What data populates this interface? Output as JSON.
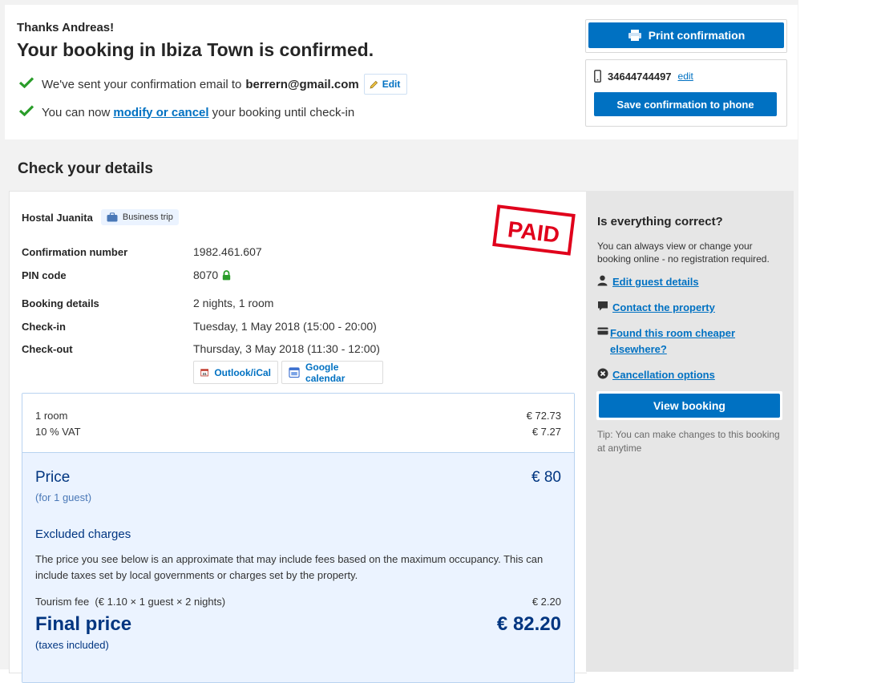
{
  "header": {
    "thanks": "Thanks Andreas!",
    "headline": "Your booking in Ibiza Town is confirmed.",
    "email_prefix": "We've sent your confirmation email to",
    "email": "berrern@gmail.com",
    "email_edit_label": "Edit",
    "modify_prefix": "You can now",
    "modify_link": "modify or cancel",
    "modify_suffix": "your booking until check-in",
    "print_label": "Print confirmation",
    "phone_number": "34644744497",
    "phone_edit": "edit",
    "save_phone_label": "Save confirmation to phone"
  },
  "section_title": "Check your details",
  "details": {
    "hotel_name": "Hostal Juanita",
    "trip_badge": "Business trip",
    "stamp_text": "PAID",
    "confirmation_label": "Confirmation number",
    "confirmation_value": "1982.461.607",
    "pin_label": "PIN code",
    "pin_value": "8070",
    "booking_label": "Booking details",
    "booking_value": "2 nights, 1 room",
    "checkin_label": "Check-in",
    "checkin_value": "Tuesday, 1 May 2018 (15:00 - 20:00)",
    "checkout_label": "Check-out",
    "checkout_value": "Thursday, 3 May 2018 (11:30 - 12:00)",
    "outlook_label": "Outlook/iCal",
    "google_label": "Google calendar"
  },
  "price": {
    "room_label": "1 room",
    "room_value": "€ 72.73",
    "vat_label": "10 % VAT",
    "vat_value": "€ 7.27",
    "price_label": "Price",
    "price_value": "€ 80",
    "price_sub": "(for 1 guest)",
    "excluded_title": "Excluded charges",
    "excluded_text": "The price you see below is an approximate that may include fees based on the maximum occupancy. This can include taxes set by local governments or charges set by the property.",
    "tourism_label": "Tourism fee  (€ 1.10 × 1 guest × 2 nights)",
    "tourism_value": "€ 2.20",
    "final_label": "Final price",
    "final_value": "€ 82.20",
    "final_sub": "(taxes included)"
  },
  "sidebar": {
    "title": "Is everything correct?",
    "text": "You can always view or change your booking online - no registration required.",
    "links": [
      {
        "label": "Edit guest details",
        "icon": "person-icon"
      },
      {
        "label": "Contact the property",
        "icon": "chat-icon"
      },
      {
        "label": "Found this room cheaper elsewhere?",
        "icon": "card-icon"
      },
      {
        "label": "Cancellation options",
        "icon": "cancel-icon"
      }
    ],
    "view_booking_label": "View booking",
    "tip": "Tip: You can make changes to this booking at anytime"
  },
  "colors": {
    "primary_blue": "#0071c2",
    "dark_blue": "#003580",
    "check_green": "#2a9d2a",
    "stamp_red": "#e0001b"
  }
}
